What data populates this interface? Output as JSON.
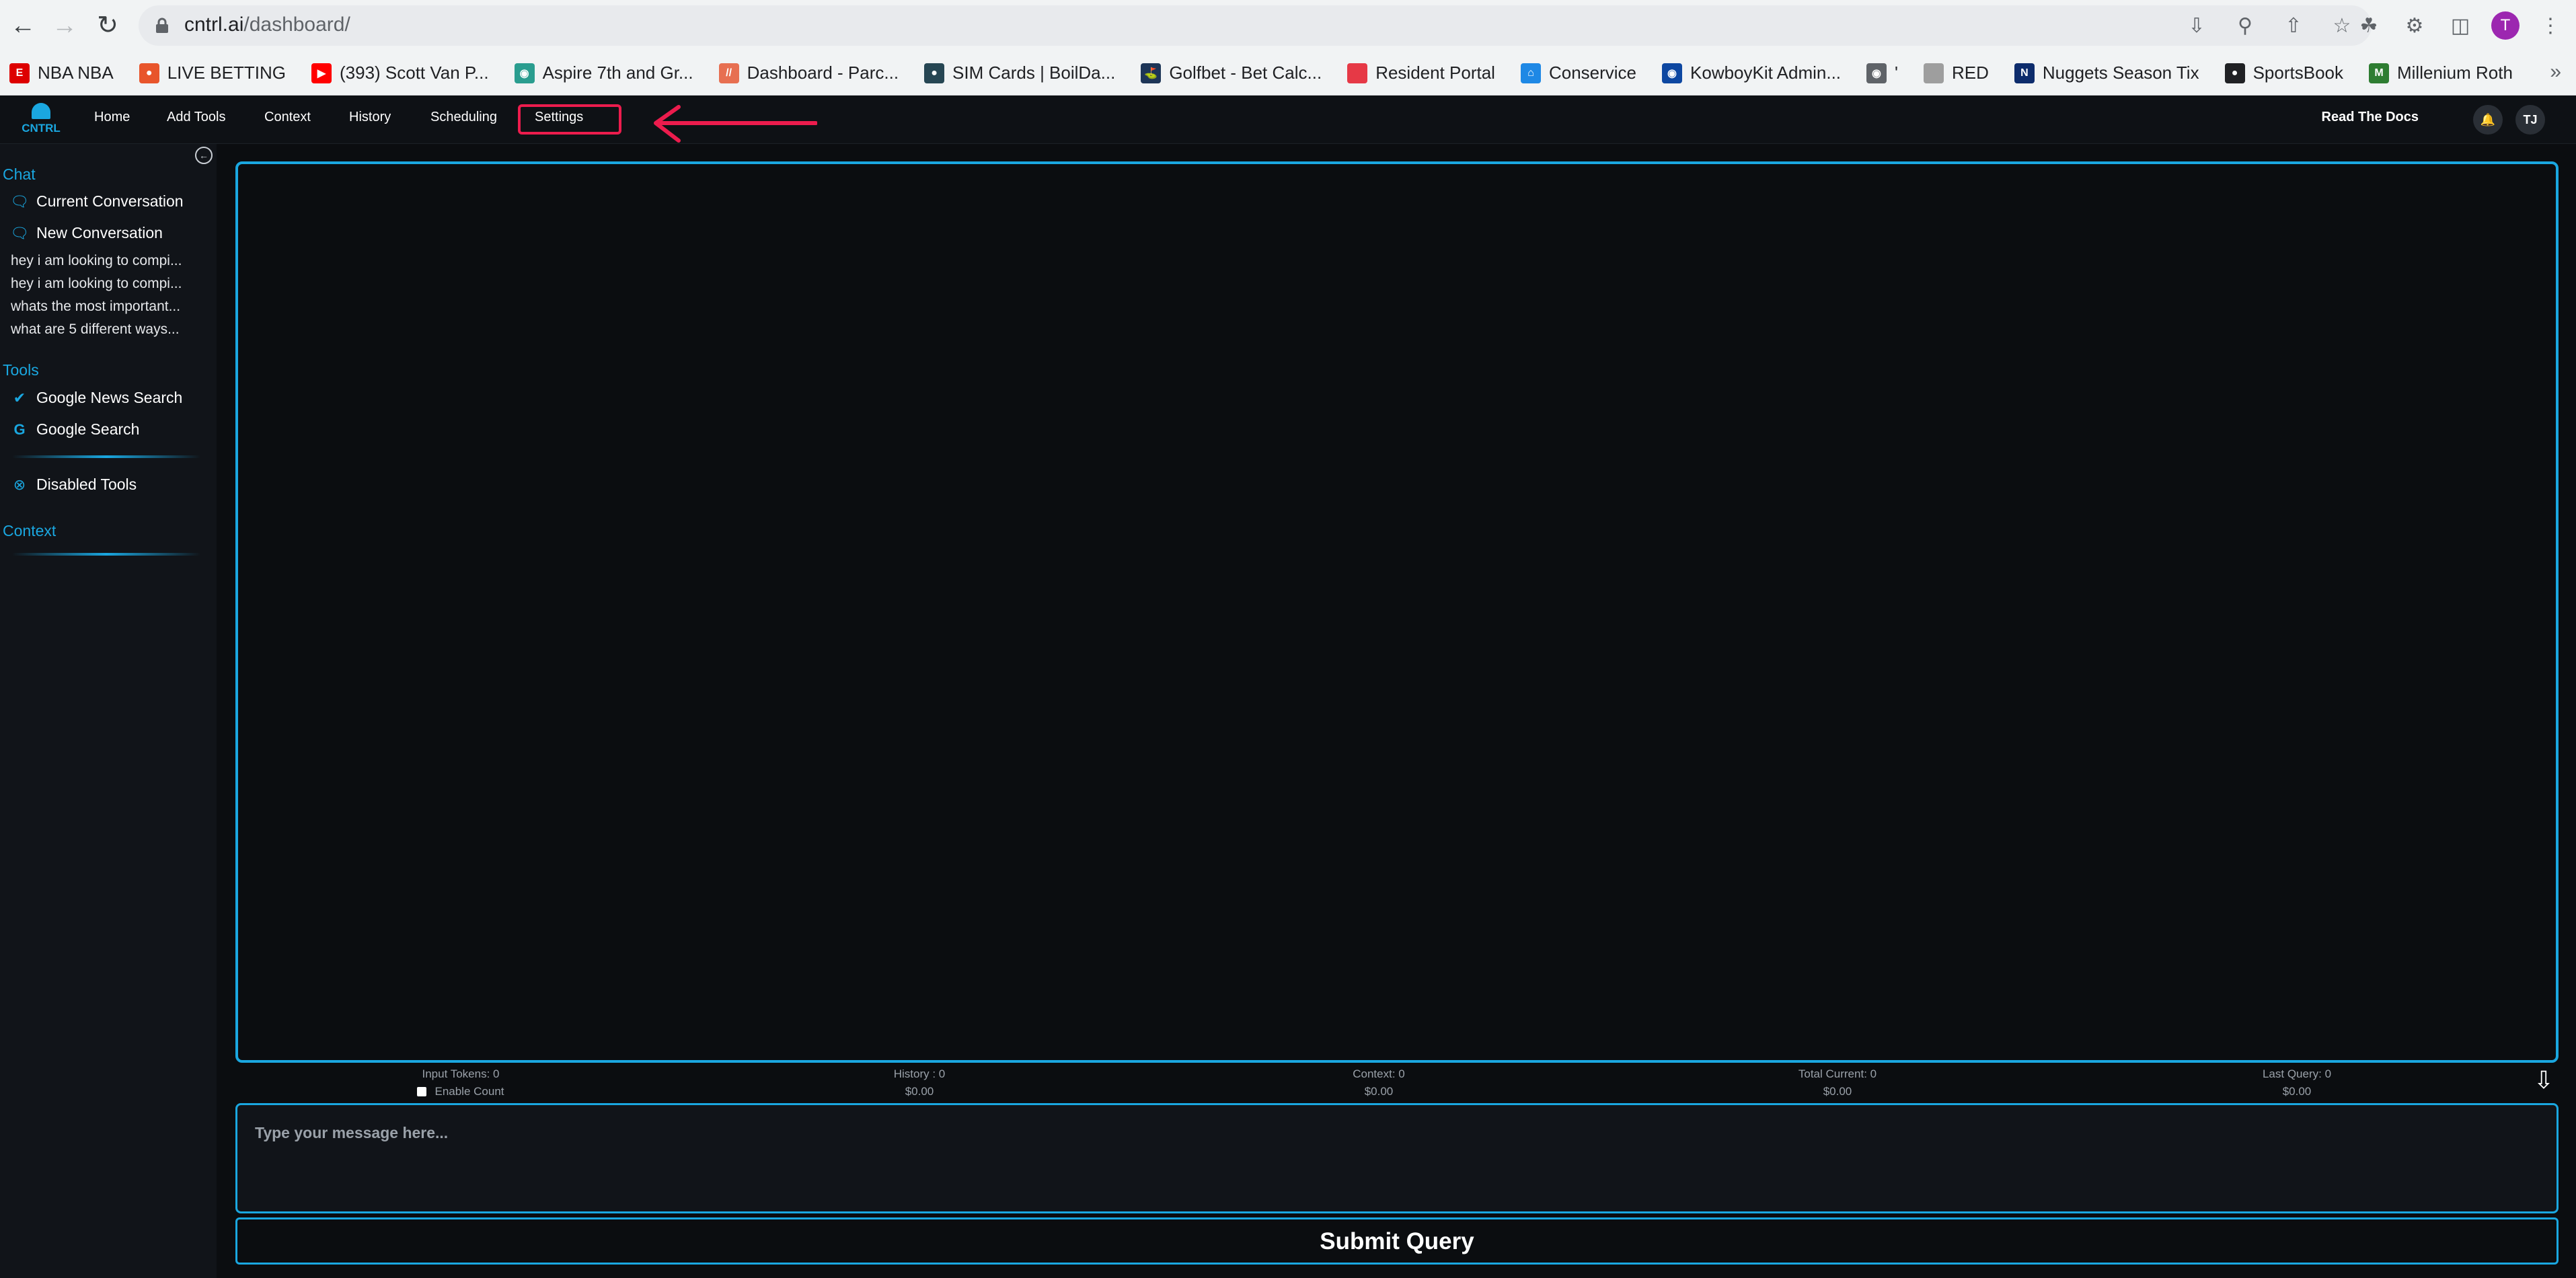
{
  "browser": {
    "url_host": "cntrl.ai",
    "url_path": "/dashboard/",
    "profile_initial": "T",
    "bookmarks": [
      {
        "label": "NBA NBA",
        "icon": "espn-icon",
        "color": "#d00"
      },
      {
        "label": "LIVE BETTING",
        "icon": "football-icon",
        "color": "#e8552b"
      },
      {
        "label": "(393) Scott Van P...",
        "icon": "youtube-icon",
        "color": "#ff0000"
      },
      {
        "label": "Aspire 7th and Gr...",
        "icon": "globe-icon",
        "color": "#2a9d8f"
      },
      {
        "label": "Dashboard - Parc...",
        "icon": "slash-icon",
        "color": "#e76f51"
      },
      {
        "label": "SIM Cards | BoilDa...",
        "icon": "drop-icon",
        "color": "#264653"
      },
      {
        "label": "Golfbet - Bet Calc...",
        "icon": "golf-icon",
        "color": "#1d3557"
      },
      {
        "label": "Resident Portal",
        "icon": "square-icon",
        "color": "#e63946"
      },
      {
        "label": "Conservice",
        "icon": "house-icon",
        "color": "#1e88e5"
      },
      {
        "label": "KowboyKit Admin...",
        "icon": "shield-icon",
        "color": "#0d47a1"
      },
      {
        "label": "'",
        "icon": "globe-icon",
        "color": "#5f6368"
      },
      {
        "label": "RED",
        "icon": "page-icon",
        "color": "#9e9e9e"
      },
      {
        "label": "Nuggets Season Tix",
        "icon": "nuggets-icon",
        "color": "#0d2c6c"
      },
      {
        "label": "SportsBook",
        "icon": "football-icon",
        "color": "#202124"
      },
      {
        "label": "Millenium Roth",
        "icon": "m-icon",
        "color": "#2e7d32"
      }
    ]
  },
  "app": {
    "logo_text": "CNTRL",
    "nav": [
      "Home",
      "Add Tools",
      "Context",
      "History",
      "Scheduling",
      "Settings"
    ],
    "read_docs": "Read The Docs",
    "user_initials": "TJ"
  },
  "sidebar": {
    "chat_title": "Chat",
    "current_conversation": "Current Conversation",
    "new_conversation": "New Conversation",
    "history": [
      "hey i am looking to compi...",
      "hey i am looking to compi...",
      "whats the most important...",
      "what are 5 different ways..."
    ],
    "tools_title": "Tools",
    "tools": [
      "Google News Search",
      "Google Search"
    ],
    "disabled_tools": "Disabled Tools",
    "context_title": "Context"
  },
  "stats": {
    "input_tokens": "Input Tokens: 0",
    "enable_count": "Enable Count",
    "history": "History : 0",
    "history_cost": "$0.00",
    "context": "Context: 0",
    "context_cost": "$0.00",
    "total_current": "Total Current: 0",
    "total_cost": "$0.00",
    "last_query": "Last Query: 0",
    "last_cost": "$0.00"
  },
  "composer": {
    "placeholder": "Type your message here...",
    "submit_label": "Submit Query"
  },
  "colors": {
    "accent": "#1aa7e0",
    "highlight": "#ec1c4d"
  }
}
